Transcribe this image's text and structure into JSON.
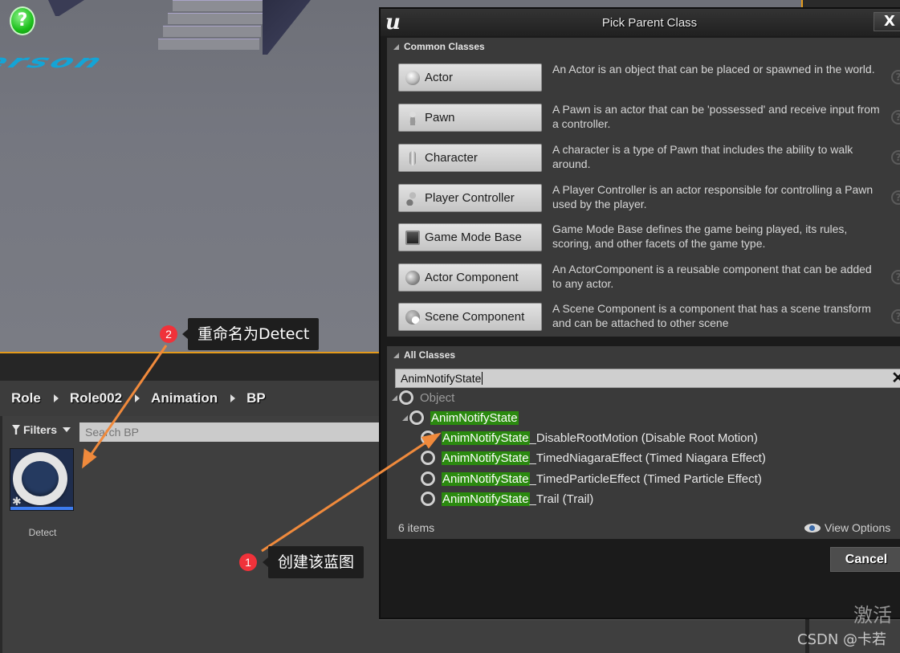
{
  "viewport": {
    "floor_text": "erson",
    "help_icon": "?"
  },
  "content_browser": {
    "breadcrumb": [
      "Role",
      "Role002",
      "Animation",
      "BP"
    ],
    "filters_label": "Filters",
    "search_placeholder": "Search BP",
    "assets": [
      {
        "name": "Detect",
        "icon": "blueprint-ring-icon"
      }
    ]
  },
  "dialog": {
    "title": "Pick Parent Class",
    "close_label": "X",
    "common_classes": {
      "header": "Common Classes",
      "items": [
        {
          "label": "Actor",
          "icon": "actor-icon",
          "description": "An Actor is an object that can be placed or spawned in the world.",
          "help": true
        },
        {
          "label": "Pawn",
          "icon": "pawn-icon",
          "description": "A Pawn is an actor that can be 'possessed' and receive input from a controller.",
          "help": true
        },
        {
          "label": "Character",
          "icon": "character-icon",
          "description": "A character is a type of Pawn that includes the ability to walk around.",
          "help": true
        },
        {
          "label": "Player Controller",
          "icon": "player-controller-icon",
          "description": "A Player Controller is an actor responsible for controlling a Pawn used by the player.",
          "help": true
        },
        {
          "label": "Game Mode Base",
          "icon": "game-mode-icon",
          "description": "Game Mode Base defines the game being played, its rules, scoring, and other facets of the game type.",
          "help": false
        },
        {
          "label": "Actor Component",
          "icon": "actor-component-icon",
          "description": "An ActorComponent is a reusable component that can be added to any actor.",
          "help": true
        },
        {
          "label": "Scene Component",
          "icon": "scene-component-icon",
          "description": "A Scene Component is a component that has a scene transform and can be attached to other scene",
          "help": true
        }
      ]
    },
    "all_classes": {
      "header": "All Classes",
      "search_value": "AnimNotifyState",
      "highlight": "AnimNotifyState",
      "tree": [
        {
          "level": 0,
          "expandable": true,
          "match": "",
          "rest": "Object",
          "muted": true
        },
        {
          "level": 1,
          "expandable": true,
          "match": "AnimNotifyState",
          "rest": ""
        },
        {
          "level": 2,
          "expandable": false,
          "match": "AnimNotifyState",
          "rest": "_DisableRootMotion (Disable Root Motion)"
        },
        {
          "level": 2,
          "expandable": false,
          "match": "AnimNotifyState",
          "rest": "_TimedNiagaraEffect (Timed Niagara Effect)"
        },
        {
          "level": 2,
          "expandable": false,
          "match": "AnimNotifyState",
          "rest": "_TimedParticleEffect (Timed Particle Effect)"
        },
        {
          "level": 2,
          "expandable": false,
          "match": "AnimNotifyState",
          "rest": "_Trail (Trail)"
        }
      ],
      "items_count": "6 items",
      "view_options_label": "View Options"
    },
    "cancel_label": "Cancel"
  },
  "annotations": [
    {
      "number": "1",
      "text": "创建该蓝图"
    },
    {
      "number": "2",
      "text": "重命名为Detect"
    }
  ],
  "colors": {
    "highlight_green": "#2b8a0f",
    "annotation_arrow": "#f08a3c",
    "badge_red": "#f0323a",
    "accent_orange": "#e49a1b"
  },
  "watermark": {
    "activate": "激活",
    "csdn": "CSDN @卡若"
  }
}
